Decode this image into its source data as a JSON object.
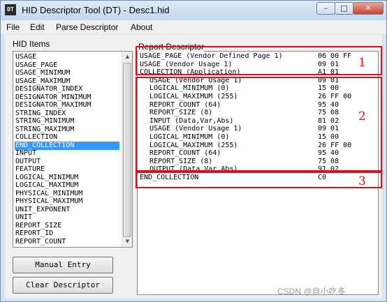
{
  "window": {
    "title": "HID Descriptor Tool (DT) - Desc1.hid",
    "app_icon": "DT"
  },
  "window_buttons": {
    "minimize": "–",
    "maximize": "□",
    "close": "✕"
  },
  "menu": [
    "File",
    "Edit",
    "Parse Descriptor",
    "About"
  ],
  "hid_items": {
    "label": "HID Items",
    "items": [
      "USAGE",
      "USAGE_PAGE",
      "USAGE_MINIMUM",
      "USAGE_MAXIMUM",
      "DESIGNATOR_INDEX",
      "DESIGNATOR_MINIMUM",
      "DESIGNATOR_MAXIMUM",
      "STRING_INDEX",
      "STRING_MINIMUM",
      "STRING_MAXIMUM",
      "COLLECTION",
      "END_COLLECTION",
      "INPUT",
      "OUTPUT",
      "FEATURE",
      "LOGICAL_MINIMUM",
      "LOGICAL_MAXIMUM",
      "PHYSICAL_MINIMUM",
      "PHYSICAL_MAXIMUM",
      "UNIT_EXPONENT",
      "UNIT",
      "REPORT_SIZE",
      "REPORT_ID",
      "REPORT_COUNT"
    ],
    "selected": "END_COLLECTION"
  },
  "buttons": {
    "manual_entry": "Manual Entry",
    "clear_descriptor": "Clear Descriptor"
  },
  "report": {
    "label": "Report Descriptor",
    "rows": [
      {
        "text": "USAGE_PAGE (Vendor Defined Page 1)",
        "hex": "06 00 FF",
        "indent": 0
      },
      {
        "text": "USAGE (Vendor Usage 1)",
        "hex": "09 01",
        "indent": 0
      },
      {
        "text": "COLLECTION (Application)",
        "hex": "A1 01",
        "indent": 0
      },
      {
        "text": "USAGE (Vendor Usage 1)",
        "hex": "09 01",
        "indent": 1
      },
      {
        "text": "LOGICAL_MINIMUM (0)",
        "hex": "15 00",
        "indent": 1
      },
      {
        "text": "LOGICAL_MAXIMUM (255)",
        "hex": "26 FF 00",
        "indent": 1
      },
      {
        "text": "REPORT_COUNT (64)",
        "hex": "95 40",
        "indent": 1
      },
      {
        "text": "REPORT_SIZE (8)",
        "hex": "75 08",
        "indent": 1
      },
      {
        "text": "INPUT (Data,Var,Abs)",
        "hex": "81 02",
        "indent": 1
      },
      {
        "text": "USAGE (Vendor Usage 1)",
        "hex": "09 01",
        "indent": 1
      },
      {
        "text": "LOGICAL_MINIMUM (0)",
        "hex": "15 00",
        "indent": 1
      },
      {
        "text": "LOGICAL_MAXIMUM (255)",
        "hex": "26 FF 00",
        "indent": 1
      },
      {
        "text": "REPORT_COUNT (64)",
        "hex": "95 40",
        "indent": 1
      },
      {
        "text": "REPORT_SIZE (8)",
        "hex": "75 08",
        "indent": 1
      },
      {
        "text": "OUTPUT (Data,Var,Abs)",
        "hex": "91 02",
        "indent": 1
      },
      {
        "text": "END_COLLECTION",
        "hex": "C0",
        "indent": 0
      }
    ]
  },
  "annotations": [
    "1",
    "2",
    "3"
  ],
  "annotation_color": "#e0101a",
  "selection_color": "#3399ff",
  "watermark": "CSDN @自小吃多"
}
